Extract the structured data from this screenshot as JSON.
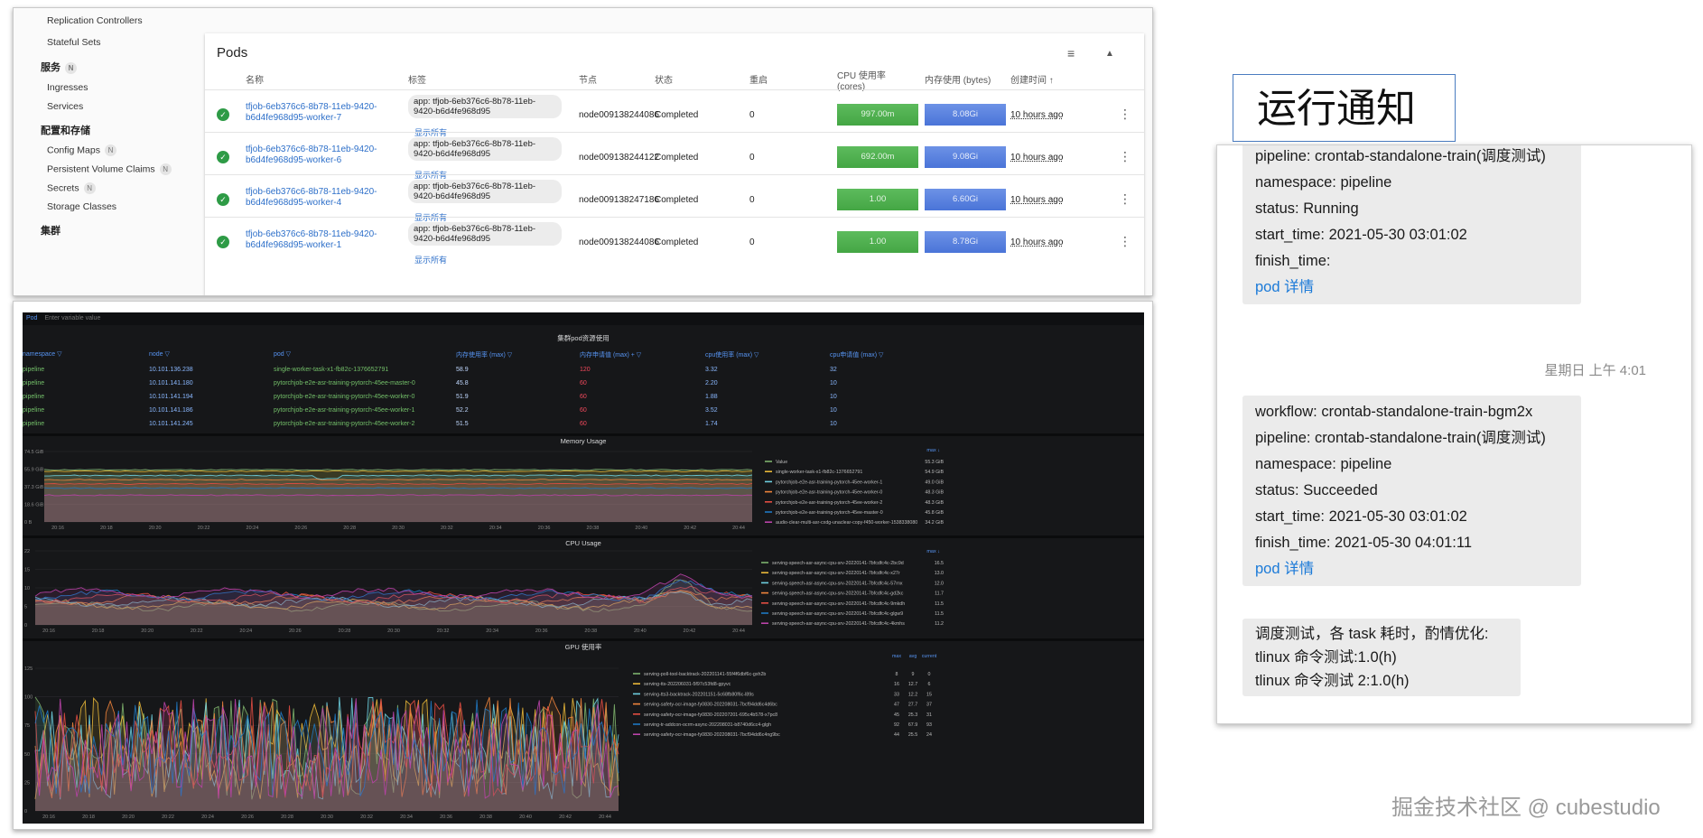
{
  "k8s": {
    "sidebar": {
      "top_item": "Replication Controllers",
      "stateful_sets": "Stateful Sets",
      "section_service": "服务",
      "ingresses": "Ingresses",
      "services": "Services",
      "section_config": "配置和存储",
      "config_maps": "Config Maps",
      "pvc": "Persistent Volume Claims",
      "secrets": "Secrets",
      "storage_classes": "Storage Classes",
      "section_cluster": "集群",
      "badge": "N"
    },
    "card": {
      "title": "Pods",
      "columns": [
        "名称",
        "标签",
        "节点",
        "状态",
        "重启",
        "CPU 使用率\n(cores)",
        "内存使用 (bytes)",
        "创建时间 ↑"
      ],
      "rows": [
        {
          "name": "tfjob-6eb376c6-8b78-11eb-9420-b6d4fe968d95-worker-7",
          "label": "app: tfjob-6eb376c6-8b78-11eb-9420-b6d4fe968d95",
          "more": "显示所有",
          "node": "node009138244086",
          "status": "Completed",
          "restarts": "0",
          "cpu": "997.00m",
          "mem": "8.08Gi",
          "age": "10 hours ago"
        },
        {
          "name": "tfjob-6eb376c6-8b78-11eb-9420-b6d4fe968d95-worker-6",
          "label": "app: tfjob-6eb376c6-8b78-11eb-9420-b6d4fe968d95",
          "more": "显示所有",
          "node": "node009138244122",
          "status": "Completed",
          "restarts": "0",
          "cpu": "692.00m",
          "mem": "9.08Gi",
          "age": "10 hours ago"
        },
        {
          "name": "tfjob-6eb376c6-8b78-11eb-9420-b6d4fe968d95-worker-4",
          "label": "app: tfjob-6eb376c6-8b78-11eb-9420-b6d4fe968d95",
          "more": "显示所有",
          "node": "node009138247186",
          "status": "Completed",
          "restarts": "0",
          "cpu": "1.00",
          "mem": "6.60Gi",
          "age": "10 hours ago"
        },
        {
          "name": "tfjob-6eb376c6-8b78-11eb-9420-b6d4fe968d95-worker-1",
          "label": "app: tfjob-6eb376c6-8b78-11eb-9420-b6d4fe968d95",
          "more": "显示所有",
          "node": "node009138244086",
          "status": "Completed",
          "restarts": "0",
          "cpu": "1.00",
          "mem": "8.78Gi",
          "age": "10 hours ago"
        }
      ]
    }
  },
  "grafana": {
    "var_pod": "Pod",
    "var_placeholder": "Enter variable value",
    "table_title": "集群pod资源使用",
    "table_headers": [
      "namespace ▽",
      "node ▽",
      "pod ▽",
      "内存使用率 (max) ▽",
      "内存申请值 (max) + ▽",
      "cpu使用率 (max) ▽",
      "cpu申请值 (max) ▽"
    ],
    "table_rows": [
      [
        "pipeline",
        "10.101.136.238",
        "single-worker-task-x1-fb82c-1376652791",
        "58.9",
        "120",
        "3.32",
        "32"
      ],
      [
        "pipeline",
        "10.101.141.180",
        "pytorchjob-e2e-asr-training-pytorch-45ee-master-0",
        "45.8",
        "60",
        "2.20",
        "10"
      ],
      [
        "pipeline",
        "10.101.141.194",
        "pytorchjob-e2e-asr-training-pytorch-45ee-worker-0",
        "51.9",
        "60",
        "1.88",
        "10"
      ],
      [
        "pipeline",
        "10.101.141.186",
        "pytorchjob-e2e-asr-training-pytorch-45ee-worker-1",
        "52.2",
        "60",
        "3.52",
        "10"
      ],
      [
        "pipeline",
        "10.101.141.245",
        "pytorchjob-e2e-asr-training-pytorch-45ee-worker-2",
        "51.5",
        "60",
        "1.74",
        "10"
      ]
    ],
    "memory": {
      "title": "Memory Usage",
      "yticks": [
        "74.5 GiB",
        "55.9 GiB",
        "37.3 GiB",
        "18.6 GiB",
        "0 B"
      ],
      "xticks": [
        "20:16",
        "20:18",
        "20:20",
        "20:22",
        "20:24",
        "20:26",
        "20:28",
        "20:30",
        "20:32",
        "20:34",
        "20:36",
        "20:38",
        "20:40",
        "20:42",
        "20:44"
      ],
      "legend_header": "max ↓",
      "legend": [
        {
          "name": "Value",
          "value": "55.3 GiB",
          "color": "#7eb26d"
        },
        {
          "name": "single-worker-task-x1-fb82c-1376652791",
          "value": "54.9 GiB",
          "color": "#eab839"
        },
        {
          "name": "pytorchjob-e2e-asr-training-pytorch-45ee-worker-1",
          "value": "49.0 GiB",
          "color": "#6ed0e0"
        },
        {
          "name": "pytorchjob-e2e-asr-training-pytorch-45ee-worker-0",
          "value": "48.3 GiB",
          "color": "#ef843c"
        },
        {
          "name": "pytorchjob-e2e-asr-training-pytorch-45ee-worker-2",
          "value": "48.3 GiB",
          "color": "#e24d42"
        },
        {
          "name": "pytorchjob-e2e-asr-training-pytorch-45ee-master-0",
          "value": "45.8 GiB",
          "color": "#1f78c1"
        },
        {
          "name": "audio-clear-multi-asr-cxdg-unaclear-copy-f450-worker-1538338080",
          "value": "34.2 GiB",
          "color": "#ba43a9"
        }
      ]
    },
    "cpu": {
      "title": "CPU Usage",
      "yticks": [
        "22",
        "15",
        "10",
        "5",
        "0"
      ],
      "xticks": [
        "20:16",
        "20:18",
        "20:20",
        "20:22",
        "20:24",
        "20:26",
        "20:28",
        "20:30",
        "20:32",
        "20:34",
        "20:36",
        "20:38",
        "20:40",
        "20:42",
        "20:44"
      ],
      "legend_header": "max ↓",
      "legend": [
        {
          "name": "serving-speech-asr-async-cpu-srv-20220141-7bfcdfc4c-2bc9d",
          "value": "16.5",
          "color": "#7eb26d"
        },
        {
          "name": "serving-speech-asr-async-cpu-srv-20220141-7bfcdfc4c-x27r",
          "value": "13.0",
          "color": "#eab839"
        },
        {
          "name": "serving-speech-asr-async-cpu-srv-20220141-7bfcdfc4c-57rnx",
          "value": "12.0",
          "color": "#6ed0e0"
        },
        {
          "name": "serving-speech-asr-async-cpu-srv-20220141-7bfcdfc4c-gd2kc",
          "value": "11.7",
          "color": "#ef843c"
        },
        {
          "name": "serving-speech-asr-async-cpu-srv-20220141-7bfcdfc4c-9mkdh",
          "value": "11.5",
          "color": "#e24d42"
        },
        {
          "name": "serving-speech-asr-async-cpu-srv-20220141-7bfcdfc4c-glgw9",
          "value": "11.5",
          "color": "#1f78c1"
        },
        {
          "name": "serving-speech-asr-async-cpu-srv-20220141-7bfcdfc4c-4kmhs",
          "value": "11.2",
          "color": "#ba43a9"
        }
      ]
    },
    "gpu": {
      "title": "GPU 使用率",
      "yticks": [
        "125",
        "100",
        "75",
        "50",
        "25",
        "0"
      ],
      "xticks": [
        "20:16",
        "20:18",
        "20:20",
        "20:22",
        "20:24",
        "20:26",
        "20:28",
        "20:30",
        "20:32",
        "20:34",
        "20:36",
        "20:38",
        "20:40",
        "20:42",
        "20:44"
      ],
      "legend_header": [
        "max",
        "avg",
        "current"
      ],
      "legend": [
        {
          "name": "serving-poll-tool-backtrack-202201141-55f4f6dbf6c-gxh2b",
          "max": "8",
          "avg": "9",
          "current": "0",
          "color": "#7eb26d"
        },
        {
          "name": "serving-tts-202206031-5f97c53fd8-gpyvc",
          "max": "16",
          "avg": "12.7",
          "current": "6",
          "color": "#eab839"
        },
        {
          "name": "serving-tts3-backtrack-202201151-5c68fb80f6c-l89s",
          "max": "33",
          "avg": "12.2",
          "current": "15",
          "color": "#6ed0e0"
        },
        {
          "name": "serving-safety-ocr-image-fy0830-202208031-7bcf94dd6c4d6bc",
          "max": "47",
          "avg": "27.7",
          "current": "37",
          "color": "#ef843c"
        },
        {
          "name": "serving-safety-ocr-image-fy0830-202207201-695c4b578-x7pc8",
          "max": "45",
          "avg": "25.3",
          "current": "31",
          "color": "#e24d42"
        },
        {
          "name": "serving-tr-addcon-ocrm-async-202208031-b8740d6cc4-glgh",
          "max": "92",
          "avg": "67.9",
          "current": "93",
          "color": "#1f78c1"
        },
        {
          "name": "serving-safety-ocr-image-fy0830-202208031-7bcf94dd6c4ng9bc",
          "max": "44",
          "avg": "25.5",
          "current": "24",
          "color": "#ba43a9"
        }
      ]
    }
  },
  "notify": {
    "title": "运行通知",
    "msg1": {
      "pipeline": "pipeline: crontab-standalone-train(调度测试)",
      "namespace": "namespace: pipeline",
      "status": "status: Running",
      "start": "start_time: 2021-05-30 03:01:02",
      "finish": "finish_time:",
      "link": "pod 详情"
    },
    "time": "星期日 上午 4:01",
    "msg2": {
      "workflow": "workflow: crontab-standalone-train-bgm2x",
      "pipeline": "pipeline: crontab-standalone-train(调度测试)",
      "namespace": "namespace: pipeline",
      "status": "status: Succeeded",
      "start": "start_time: 2021-05-30 03:01:02",
      "finish": "finish_time: 2021-05-30 04:01:11",
      "link": "pod 详情"
    },
    "msg3": {
      "line1": "调度测试，各 task 耗时，酌情优化:",
      "line2": "tlinux 命令测试:1.0(h)",
      "line3": "tlinux 命令测试 2:1.0(h)"
    }
  },
  "watermark": "掘金技术社区 @ cubestudio"
}
